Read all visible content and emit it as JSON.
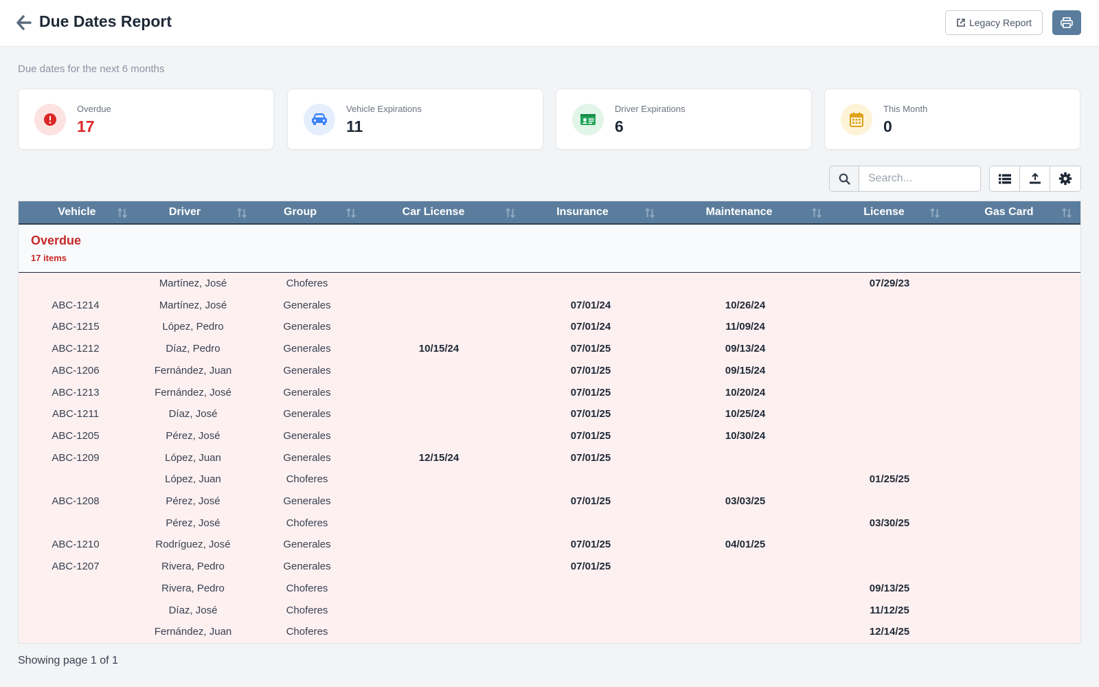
{
  "header": {
    "title": "Due Dates Report",
    "legacy_label": "Legacy Report"
  },
  "subtitle": "Due dates for the next 6 months",
  "cards": [
    {
      "label": "Overdue",
      "value": "17",
      "icon": "alert-circle-icon",
      "color": "#dc2626",
      "bg": "#fde2e2"
    },
    {
      "label": "Vehicle Expirations",
      "value": "11",
      "icon": "car-icon",
      "color": "#3b82f6",
      "bg": "#e5eefc"
    },
    {
      "label": "Driver Expirations",
      "value": "6",
      "icon": "id-card-icon",
      "color": "#22a55a",
      "bg": "#e2f5e9"
    },
    {
      "label": "This Month",
      "value": "0",
      "icon": "calendar-icon",
      "color": "#e0a21a",
      "bg": "#fdf3d6"
    }
  ],
  "search": {
    "placeholder": "Search..."
  },
  "table": {
    "columns": [
      "Vehicle",
      "Driver",
      "Group",
      "Car License",
      "Insurance",
      "Maintenance",
      "License",
      "Gas Card"
    ],
    "group": {
      "title": "Overdue",
      "count": "17 items"
    },
    "rows": [
      [
        "",
        "Martínez, José",
        "Choferes",
        "",
        "",
        "",
        "07/29/23",
        ""
      ],
      [
        "ABC-1214",
        "Martínez, José",
        "Generales",
        "",
        "07/01/24",
        "10/26/24",
        "",
        ""
      ],
      [
        "ABC-1215",
        "López, Pedro",
        "Generales",
        "",
        "07/01/24",
        "11/09/24",
        "",
        ""
      ],
      [
        "ABC-1212",
        "Díaz, Pedro",
        "Generales",
        "10/15/24",
        "07/01/25",
        "09/13/24",
        "",
        ""
      ],
      [
        "ABC-1206",
        "Fernández, Juan",
        "Generales",
        "",
        "07/01/25",
        "09/15/24",
        "",
        ""
      ],
      [
        "ABC-1213",
        "Fernández, José",
        "Generales",
        "",
        "07/01/25",
        "10/20/24",
        "",
        ""
      ],
      [
        "ABC-1211",
        "Díaz, José",
        "Generales",
        "",
        "07/01/25",
        "10/25/24",
        "",
        ""
      ],
      [
        "ABC-1205",
        "Pérez, José",
        "Generales",
        "",
        "07/01/25",
        "10/30/24",
        "",
        ""
      ],
      [
        "ABC-1209",
        "López, Juan",
        "Generales",
        "12/15/24",
        "07/01/25",
        "",
        "",
        ""
      ],
      [
        "",
        "López, Juan",
        "Choferes",
        "",
        "",
        "",
        "01/25/25",
        ""
      ],
      [
        "ABC-1208",
        "Pérez, José",
        "Generales",
        "",
        "07/01/25",
        "03/03/25",
        "",
        ""
      ],
      [
        "",
        "Pérez, José",
        "Choferes",
        "",
        "",
        "",
        "03/30/25",
        ""
      ],
      [
        "ABC-1210",
        "Rodríguez, José",
        "Generales",
        "",
        "07/01/25",
        "04/01/25",
        "",
        ""
      ],
      [
        "ABC-1207",
        "Rivera, Pedro",
        "Generales",
        "",
        "07/01/25",
        "",
        "",
        ""
      ],
      [
        "",
        "Rivera, Pedro",
        "Choferes",
        "",
        "",
        "",
        "09/13/25",
        ""
      ],
      [
        "",
        "Díaz, José",
        "Choferes",
        "",
        "",
        "",
        "11/12/25",
        ""
      ],
      [
        "",
        "Fernández, Juan",
        "Choferes",
        "",
        "",
        "",
        "12/14/25",
        ""
      ]
    ]
  },
  "footer": {
    "text": "Showing page 1 of 1"
  }
}
